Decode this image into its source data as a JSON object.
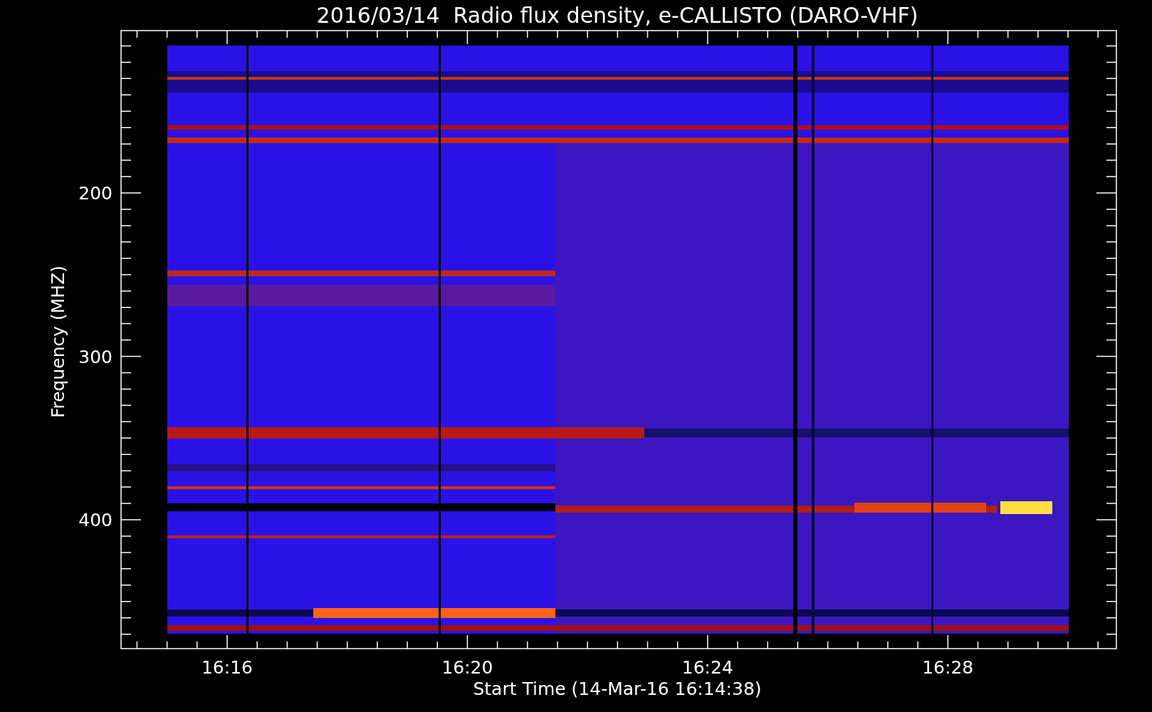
{
  "plot": {
    "title": "2016/03/14  Radio flux density, e-CALLISTO (DARO-VHF)",
    "ylabel": "Frequency (MHZ)",
    "xlabel": "Start Time (14-Mar-16 16:14:38)",
    "ytick_labels": [
      "200",
      "300",
      "400"
    ],
    "xtick_labels": [
      "16:16",
      "16:20",
      "16:24",
      "16:28"
    ]
  }
}
